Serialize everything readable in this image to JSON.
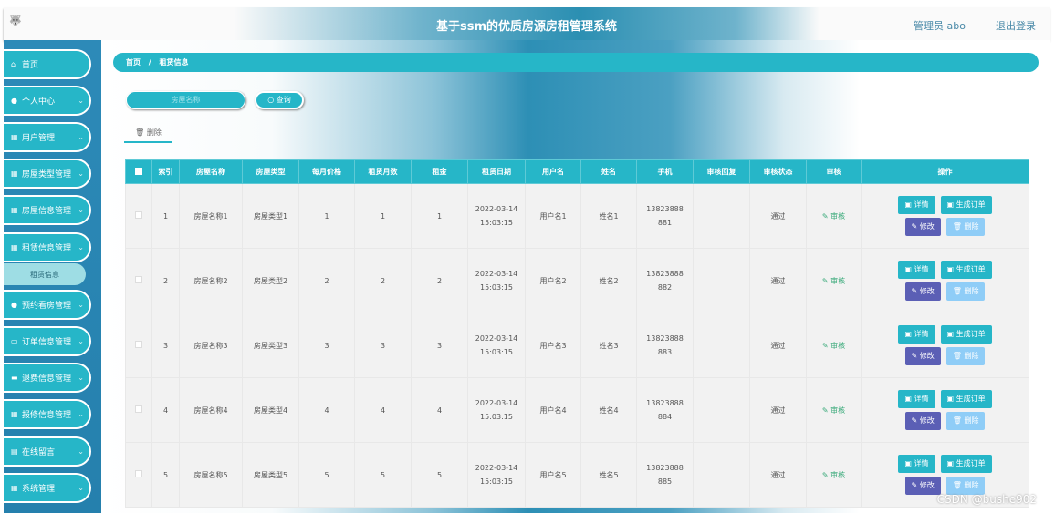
{
  "header": {
    "logo": "🐺",
    "title": "基于ssm的优质房源房租管理系统",
    "user": "管理员 abo",
    "logout": "退出登录"
  },
  "sidebar": {
    "items": [
      {
        "label": "首页",
        "icon": "home-icon",
        "glyph": "⌂",
        "chev": ""
      },
      {
        "label": "个人中心",
        "icon": "user-icon",
        "glyph": "●",
        "chev": "⌄"
      },
      {
        "label": "用户管理",
        "icon": "grid-icon",
        "glyph": "▦",
        "chev": "⌄"
      },
      {
        "label": "房屋类型管理",
        "icon": "grid-icon",
        "glyph": "▦",
        "chev": "⌄"
      },
      {
        "label": "房屋信息管理",
        "icon": "grid-icon",
        "glyph": "▦",
        "chev": "⌄"
      },
      {
        "label": "租赁信息管理",
        "icon": "grid-icon",
        "glyph": "▦",
        "chev": "⌄"
      },
      {
        "label": "预约看房管理",
        "icon": "user-icon",
        "glyph": "●",
        "chev": "⌄"
      },
      {
        "label": "订单信息管理",
        "icon": "monitor-icon",
        "glyph": "▭",
        "chev": "⌄"
      },
      {
        "label": "退费信息管理",
        "icon": "printer-icon",
        "glyph": "▬",
        "chev": "⌄"
      },
      {
        "label": "报修信息管理",
        "icon": "grid-icon",
        "glyph": "▦",
        "chev": "⌄"
      },
      {
        "label": "在线留言",
        "icon": "clipboard-icon",
        "glyph": "▤",
        "chev": "⌄"
      },
      {
        "label": "系统管理",
        "icon": "grid-icon",
        "glyph": "▦",
        "chev": "⌄"
      }
    ],
    "sub_item": "租赁信息"
  },
  "breadcrumb": {
    "home": "首页",
    "sep": "/",
    "current": "租赁信息"
  },
  "search": {
    "placeholder": "房屋名称",
    "button": "查询"
  },
  "delete_tab": "删除",
  "table": {
    "headers": [
      "索引",
      "房屋名称",
      "房屋类型",
      "每月价格",
      "租赁月数",
      "租金",
      "租赁日期",
      "用户名",
      "姓名",
      "手机",
      "审核回复",
      "审核状态",
      "审核",
      "操作"
    ],
    "rows": [
      [
        "1",
        "房屋名称1",
        "房屋类型1",
        "1",
        "1",
        "1",
        "2022-03-14 15:03:15",
        "用户名1",
        "姓名1",
        "13823888881",
        "",
        "通过"
      ],
      [
        "2",
        "房屋名称2",
        "房屋类型2",
        "2",
        "2",
        "2",
        "2022-03-14 15:03:15",
        "用户名2",
        "姓名2",
        "13823888882",
        "",
        "通过"
      ],
      [
        "3",
        "房屋名称3",
        "房屋类型3",
        "3",
        "3",
        "3",
        "2022-03-14 15:03:15",
        "用户名3",
        "姓名3",
        "13823888883",
        "",
        "通过"
      ],
      [
        "4",
        "房屋名称4",
        "房屋类型4",
        "4",
        "4",
        "4",
        "2022-03-14 15:03:15",
        "用户名4",
        "姓名4",
        "13823888884",
        "",
        "通过"
      ],
      [
        "5",
        "房屋名称5",
        "房屋类型5",
        "5",
        "5",
        "5",
        "2022-03-14 15:03:15",
        "用户名5",
        "姓名5",
        "13823888885",
        "",
        "通过"
      ]
    ],
    "audit_label": "✎ 审核",
    "actions": {
      "detail": "▣ 详情",
      "order": "▣ 生成订单",
      "edit": "✎ 修改",
      "delete": "🗑 删除"
    }
  },
  "watermark": "CSDN @bushe902"
}
